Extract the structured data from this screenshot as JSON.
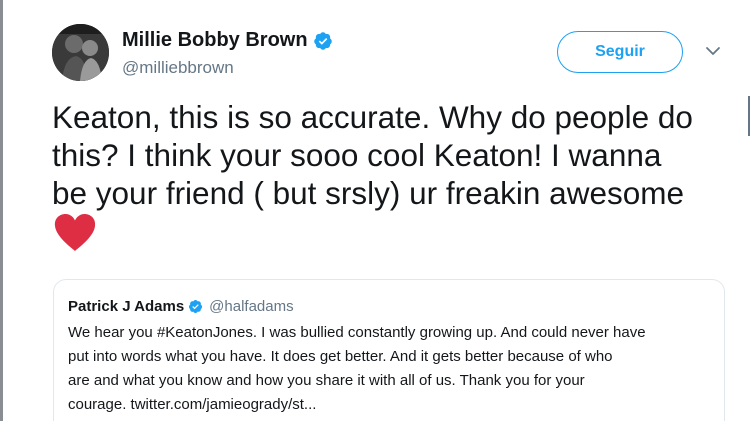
{
  "tweet": {
    "author": {
      "name": "Millie Bobby Brown",
      "handle": "@milliebbrown",
      "avatar_icon": "user-avatar-photo"
    },
    "follow_label": "Seguir",
    "menu_icon": "chevron-down-icon",
    "text_lines": [
      "Keaton, this is so accurate. Why do people do",
      "this? I think your sooo cool Keaton! I wanna",
      "be your friend ( but srsly) ur freakin awesome"
    ],
    "emoji": "red-heart",
    "quoted": {
      "name": "Patrick J Adams",
      "handle": "@halfadams",
      "text_lines": [
        "We hear you #KeatonJones. I was bullied constantly growing up. And could never have",
        "put into words what you have. It does get better. And it gets better because of who",
        "are and what you know and how you share it with all of us. Thank you for your",
        "courage. twitter.com/jamieogrady/st..."
      ]
    }
  },
  "colors": {
    "accent": "#1da1f2",
    "text": "#14171a",
    "secondary_text": "#657786",
    "border": "#e1e8ed",
    "heart": "#e0243a"
  }
}
